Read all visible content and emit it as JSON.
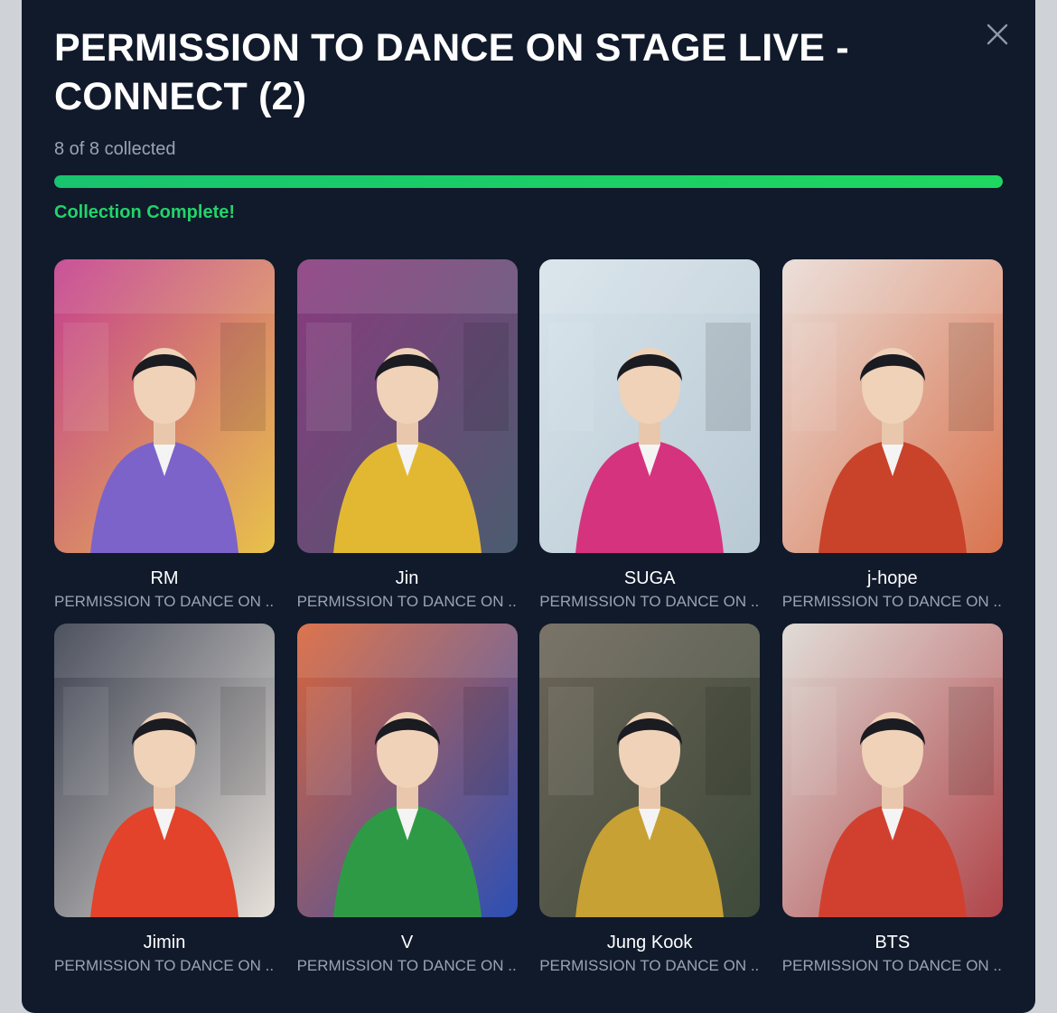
{
  "modal": {
    "title": "PERMISSION TO DANCE ON STAGE LIVE - CONNECT (2)",
    "collected_text": "8 of 8 collected",
    "progress": 1.0,
    "status_text": "Collection Complete!",
    "close_icon": "close-icon"
  },
  "colors": {
    "background": "#111a2b",
    "accent_green": "#22d36a",
    "muted_text": "#9aa3b2"
  },
  "cards": [
    {
      "name": "RM",
      "subtitle": "PERMISSION TO DANCE ON ...",
      "outfit": "#7b63c9",
      "bg": "#c43f8f",
      "bg2": "#e8c24a"
    },
    {
      "name": "Jin",
      "subtitle": "PERMISSION TO DANCE ON ...",
      "outfit": "#e2b833",
      "bg": "#8a3a7e",
      "bg2": "#4b5c6f"
    },
    {
      "name": "SUGA",
      "subtitle": "PERMISSION TO DANCE ON ...",
      "outfit": "#d6337f",
      "bg": "#d7e3ea",
      "bg2": "#b9c9d4"
    },
    {
      "name": "j-hope",
      "subtitle": "PERMISSION TO DANCE ON ...",
      "outfit": "#c8432a",
      "bg": "#e9dcd6",
      "bg2": "#d9744f"
    },
    {
      "name": "Jimin",
      "subtitle": "PERMISSION TO DANCE ON ...",
      "outfit": "#e2432a",
      "bg": "#3a3f4e",
      "bg2": "#e7e1da"
    },
    {
      "name": "V",
      "subtitle": "PERMISSION TO DANCE ON ...",
      "outfit": "#2f9a46",
      "bg": "#d9653a",
      "bg2": "#2c4fb5"
    },
    {
      "name": "Jung Kook",
      "subtitle": "PERMISSION TO DANCE ON ...",
      "outfit": "#c7a134",
      "bg": "#6b6457",
      "bg2": "#3e4a3a"
    },
    {
      "name": "BTS",
      "subtitle": "PERMISSION TO DANCE ON ...",
      "outfit": "#d1402f",
      "bg": "#ddd8d2",
      "bg2": "#b0454a"
    }
  ]
}
